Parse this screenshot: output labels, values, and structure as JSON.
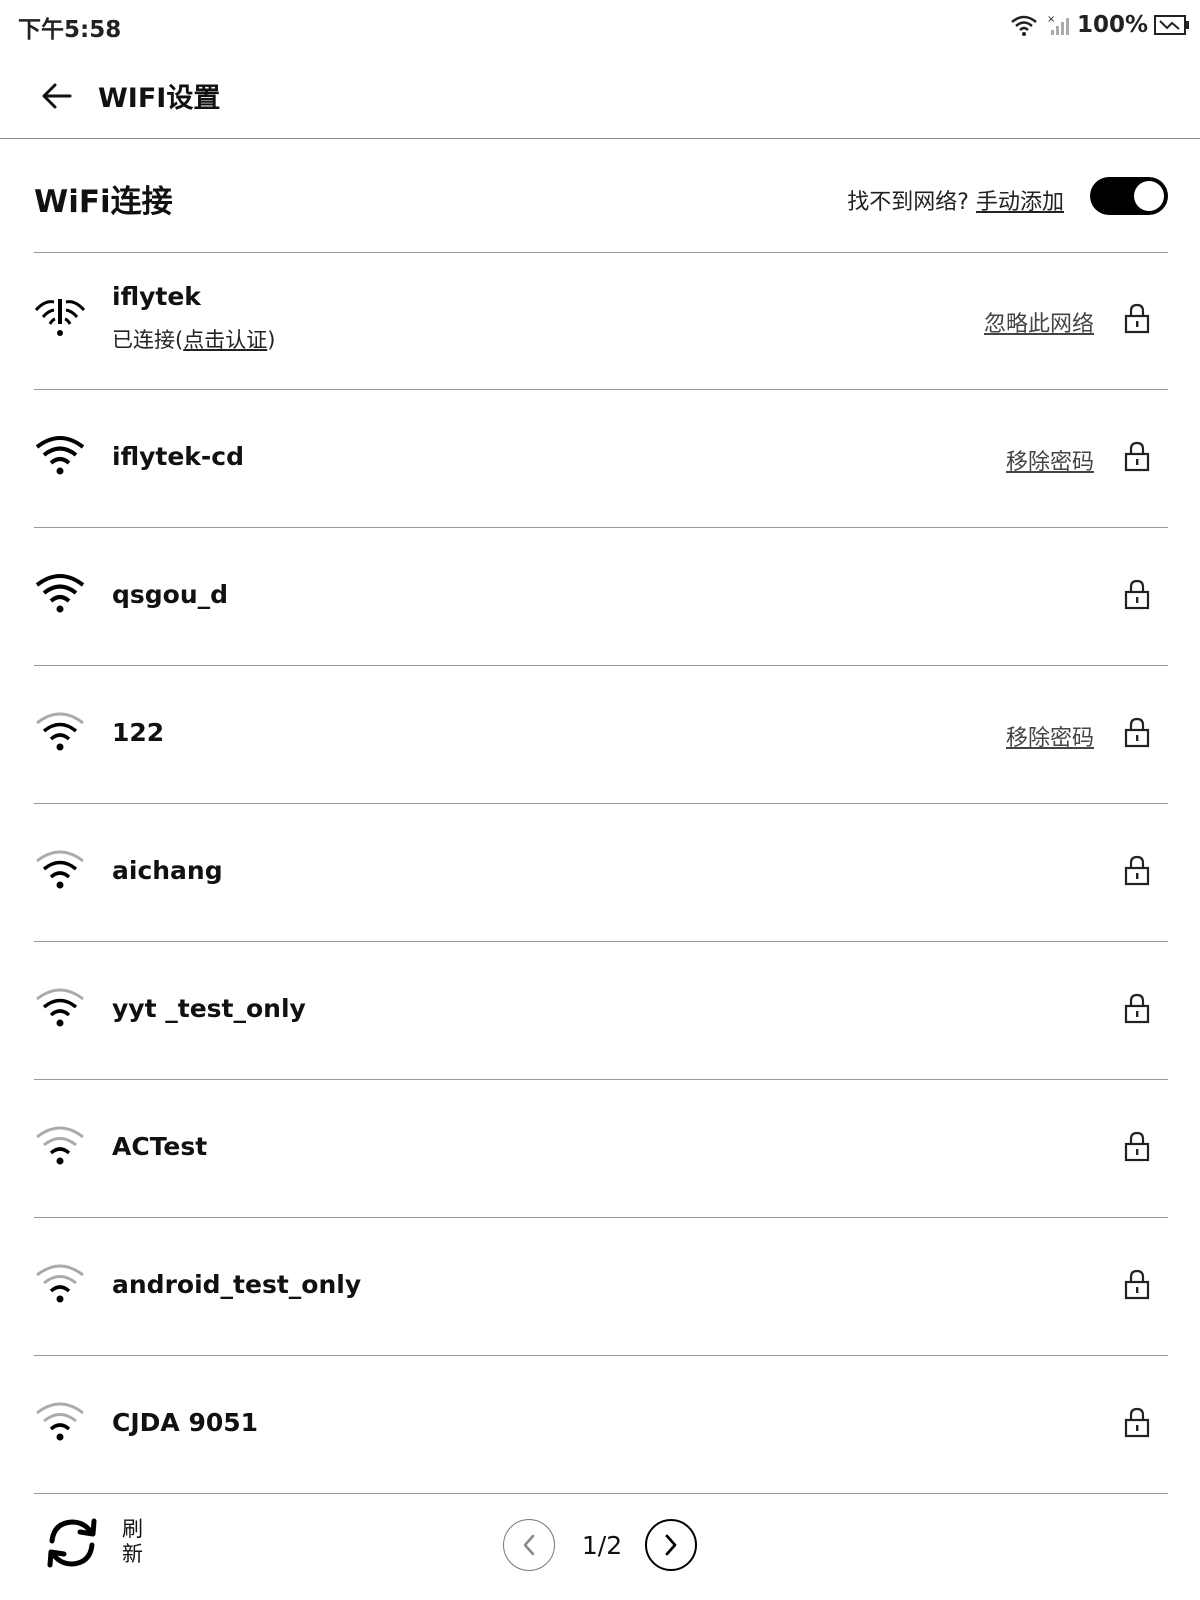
{
  "status_bar": {
    "time": "下午5:58",
    "battery_text": "100%",
    "icons": [
      "wifi-icon",
      "signal-icon",
      "battery-charging-icon"
    ]
  },
  "titlebar": {
    "title": "WIFI设置",
    "back_icon": "arrow-left-icon"
  },
  "section": {
    "title": "WiFi连接",
    "hint_prefix": "找不到网络?",
    "hint_link": "手动添加",
    "toggle_on": true
  },
  "networks": [
    {
      "ssid": "iflytek",
      "status_prefix": "已连接(",
      "status_link": "点击认证",
      "status_suffix": ")",
      "action": "忽略此网络",
      "signal": "wifi-auth-icon"
    },
    {
      "ssid": "iflytek-cd",
      "action": "移除密码",
      "signal": "wifi-strong-icon"
    },
    {
      "ssid": "qsgou_d",
      "action": "",
      "signal": "wifi-strong-icon"
    },
    {
      "ssid": "122",
      "action": "移除密码",
      "signal": "wifi-medium-icon"
    },
    {
      "ssid": "aichang",
      "action": "",
      "signal": "wifi-medium-icon"
    },
    {
      "ssid": "yyt _test_only",
      "action": "",
      "signal": "wifi-medium-icon"
    },
    {
      "ssid": "ACTest",
      "action": "",
      "signal": "wifi-weak-icon"
    },
    {
      "ssid": "android_test_only",
      "action": "",
      "signal": "wifi-weak-icon"
    },
    {
      "ssid": "CJDA 9051",
      "action": "",
      "signal": "wifi-weak-icon"
    }
  ],
  "bottom": {
    "refresh_label": "刷新",
    "page_indicator": "1/2"
  },
  "colors": {
    "accent": "#000000",
    "divider": "#9a9a9a",
    "background": "#ffffff"
  }
}
